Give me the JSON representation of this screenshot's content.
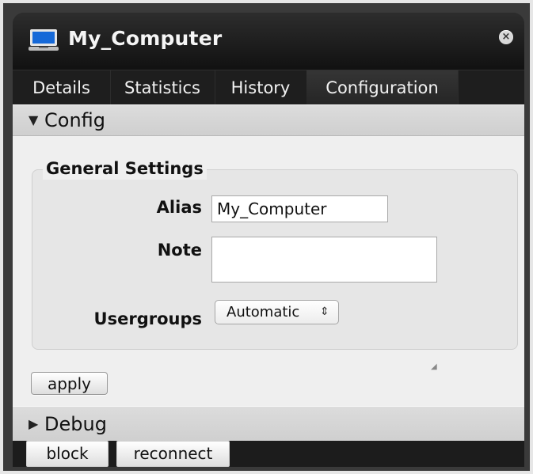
{
  "window": {
    "title": "My_Computer",
    "close_icon": "x-circle-icon",
    "monitor_icon": "laptop-monitor-icon"
  },
  "tabs": [
    {
      "label": "Details",
      "active": false
    },
    {
      "label": "Statistics",
      "active": false
    },
    {
      "label": "History",
      "active": false
    },
    {
      "label": "Configuration",
      "active": true
    }
  ],
  "sections": {
    "config": {
      "title": "Config",
      "state": "expanded",
      "arrow_icon": "triangle-down-icon"
    },
    "debug": {
      "title": "Debug",
      "state": "collapsed",
      "arrow_icon": "triangle-right-icon"
    }
  },
  "general_settings": {
    "legend": "General Settings",
    "alias": {
      "label": "Alias",
      "value": "My_Computer"
    },
    "note": {
      "label": "Note",
      "value": ""
    },
    "usergroups": {
      "label": "Usergroups",
      "value": "Automatic",
      "arrow_icon": "updown-chevron-icon"
    }
  },
  "actions": {
    "apply": "apply",
    "block": "block",
    "reconnect": "reconnect"
  },
  "colors": {
    "window_dark": "#1b1b1b",
    "panel_light": "#efefef",
    "section_header": "#d6d6d6"
  }
}
